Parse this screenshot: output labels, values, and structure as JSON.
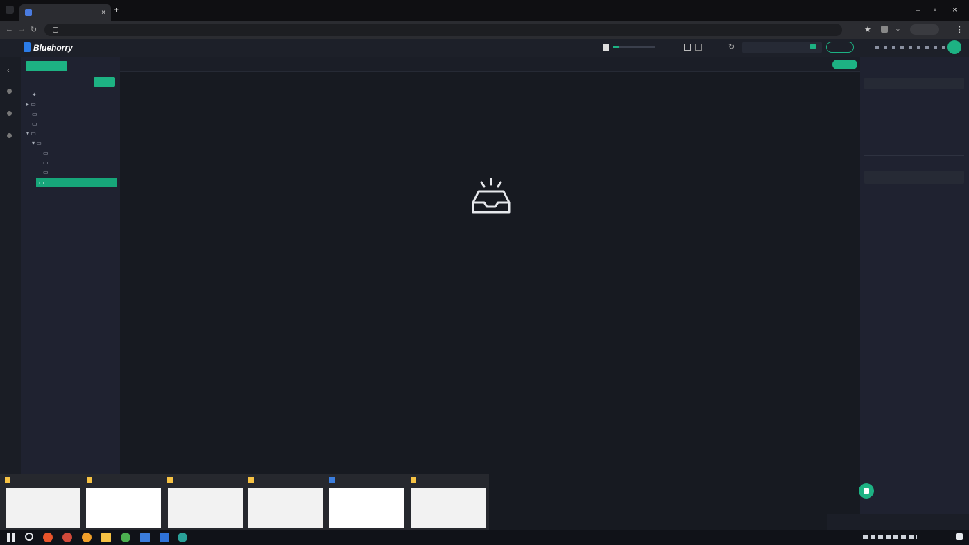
{
  "browser": {
    "tab_title": "",
    "url": "",
    "new_tab": "+",
    "tab_close": "×",
    "window": {
      "minimize": "–",
      "restore": "▫",
      "close": "×"
    }
  },
  "app": {
    "logo": "Bluehorry",
    "breadcrumb": "",
    "search_value": "",
    "header_button": ""
  },
  "sidebar": {
    "tabs": [
      "",
      ""
    ],
    "section_label": "",
    "filter_label": "",
    "new_button": "",
    "tree": [
      {
        "label": "",
        "level": 1
      },
      {
        "label": "",
        "level": 1
      },
      {
        "label": "",
        "level": 2
      },
      {
        "label": "",
        "level": 2
      },
      {
        "label": "",
        "level": 1
      },
      {
        "label": "",
        "level": 2
      },
      {
        "label": "",
        "level": 3
      },
      {
        "label": "",
        "level": 3
      },
      {
        "label": "",
        "level": 3
      },
      {
        "label": "",
        "level": 3,
        "selected": true
      }
    ]
  },
  "toolbar": {
    "items": [
      "",
      "",
      "",
      "",
      "",
      "",
      "",
      "",
      "",
      "",
      "",
      "",
      "",
      "",
      "",
      "",
      "",
      "",
      ""
    ],
    "right_action": "",
    "upload_button": ""
  },
  "main": {
    "empty_text": ""
  },
  "right_panel": {
    "file_name": "",
    "input_placeholder": "",
    "section_title": "",
    "props": [
      {
        "key": "",
        "value": ""
      },
      {
        "key": "",
        "value": ""
      },
      {
        "key": "",
        "value": ""
      },
      {
        "key": "",
        "value": ""
      }
    ],
    "tags_title": "",
    "tags_action": "",
    "tags_placeholder": ""
  },
  "upload_bar": {
    "label": ""
  },
  "thumbnails": [
    {
      "title": "",
      "color": "#f6c244"
    },
    {
      "title": "",
      "color": "#f6c244"
    },
    {
      "title": "",
      "color": "#f6c244"
    },
    {
      "title": "",
      "color": "#f6c244"
    },
    {
      "title": "",
      "color": "#3b7ddd"
    },
    {
      "title": "",
      "color": "#f6c244"
    }
  ],
  "taskbar": {
    "clock": ""
  },
  "colors": {
    "accent": "#1db283",
    "bg_main": "#171a21",
    "bg_panel": "#1f2230"
  }
}
